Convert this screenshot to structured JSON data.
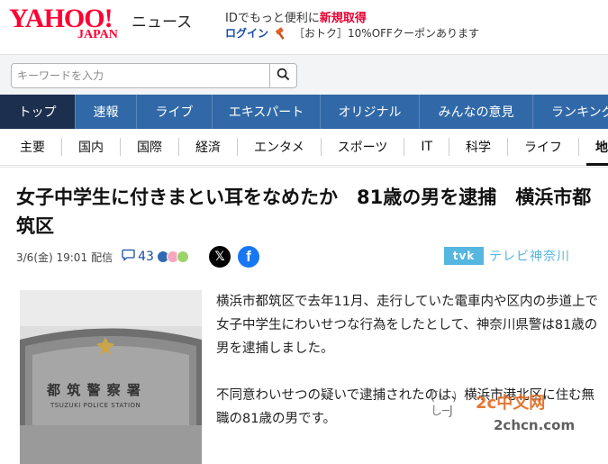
{
  "header": {
    "logo_main": "YAHOO!",
    "logo_sub": "JAPAN",
    "logo_news": "ニュース",
    "promo_prefix": "IDでもっと便利に",
    "promo_link": "新規取得",
    "login_label": "ログイン",
    "coupon_text": "［おトク］10%OFFクーポンあります"
  },
  "search": {
    "placeholder": "キーワードを入力",
    "icon": "search-icon"
  },
  "main_nav": [
    "トップ",
    "速報",
    "ライブ",
    "エキスパート",
    "オリジナル",
    "みんなの意見",
    "ランキング"
  ],
  "sub_nav": [
    "主要",
    "国内",
    "国際",
    "経済",
    "エンタメ",
    "スポーツ",
    "IT",
    "科学",
    "ライフ",
    "地域"
  ],
  "article": {
    "headline": "女子中学生に付きまとい耳をなめたか　81歳の男を逮捕　横浜市都筑区",
    "datetime": "3/6(金) 19:01",
    "status": "配信",
    "comment_count": "43",
    "source_logo": "tvk",
    "source_name": "テレビ神奈川",
    "photo_sign_main": "都 筑 警 察 署",
    "photo_sign_sub": "TSUZUKI POLICE STATION",
    "paragraphs": [
      "横浜市都筑区で去年11月、走行していた電車内や区内の歩道上で女子中学生にわいせつな行為をしたとして、神奈川県警は81歳の男を逮捕しました。",
      "不同意わいせつの疑いで逮捕されたのは、横浜市港北区に住む無職の81歳の男です。"
    ]
  },
  "watermark": {
    "text_cn": "2c中文网",
    "url": "2chcn.com"
  },
  "colors": {
    "brand": "#ff0033",
    "nav_bg": "#3169a8",
    "nav_active": "#1c2f4f",
    "source": "#55b6df"
  }
}
